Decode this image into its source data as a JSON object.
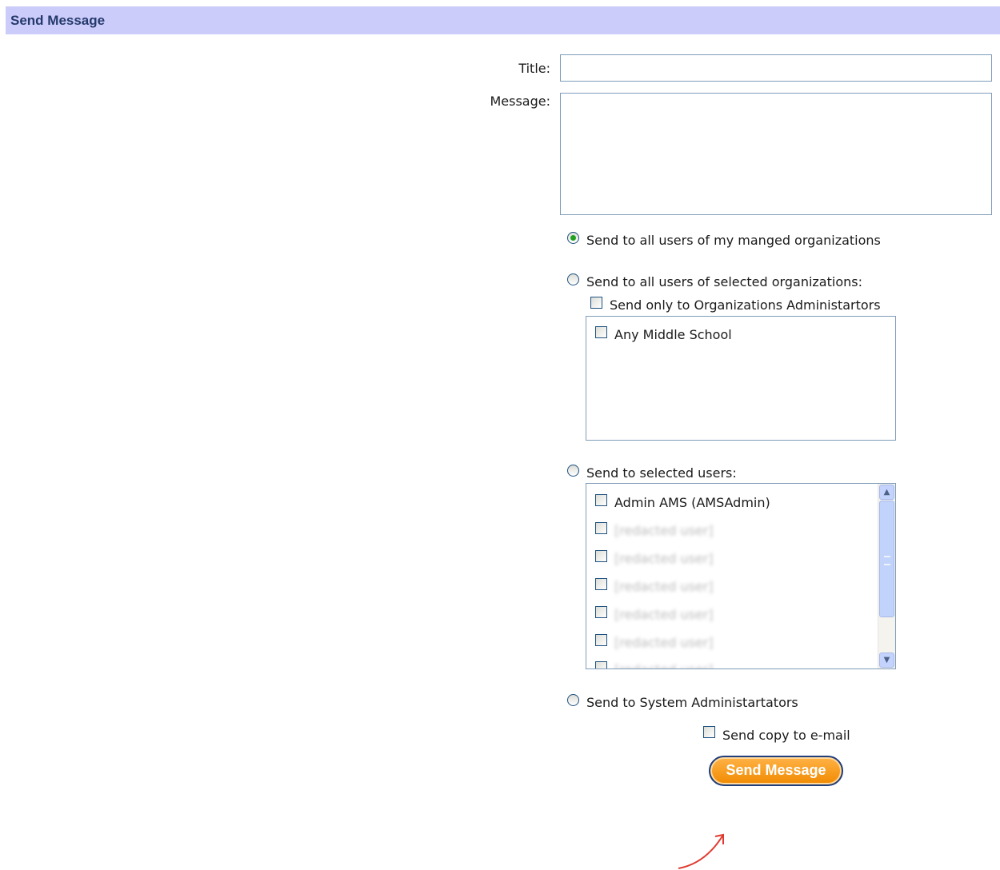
{
  "header": {
    "title": "Send Message"
  },
  "form": {
    "title_label": "Title:",
    "title_value": "",
    "message_label": "Message:",
    "message_value": "",
    "option_managed": "Send to all users of my manged organizations",
    "option_selected_orgs": "Send to all users of selected organizations:",
    "only_admins_label": "Send only to Organizations Administartors",
    "organizations": [
      "Any Middle School"
    ],
    "option_selected_users": "Send to selected users:",
    "users": [
      "Admin AMS (AMSAdmin)",
      "[redacted user]",
      "[redacted user]",
      "[redacted user]",
      "[redacted user]",
      "[redacted user]",
      "[redacted user]"
    ],
    "option_sysadmins": "Send to System Administartators",
    "send_copy_label": "Send copy to e-mail",
    "send_button": "Send Message",
    "selected_option": "managed"
  },
  "colors": {
    "header_bg": "#ccccfb",
    "header_text": "#243a6b",
    "button_orange": "#f08a00",
    "button_border": "#1f3e7a"
  }
}
